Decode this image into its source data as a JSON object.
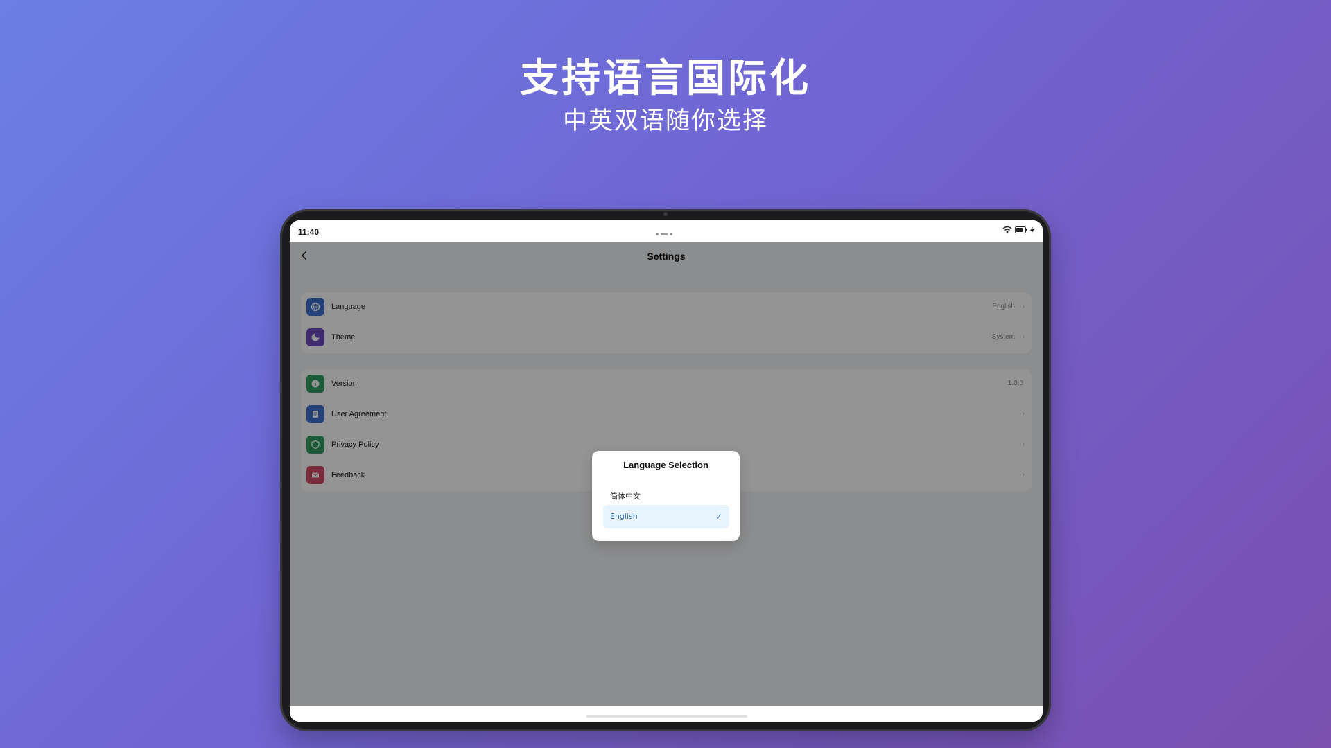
{
  "hero": {
    "title": "支持语言国际化",
    "subtitle": "中英双语随你选择"
  },
  "status_bar": {
    "time": "11:40",
    "icons": [
      "wifi-icon",
      "battery-icon",
      "charging-icon"
    ]
  },
  "header": {
    "title": "Settings",
    "back_icon": "chevron-left-icon"
  },
  "settings": {
    "group1": [
      {
        "label": "Language",
        "value": "English",
        "icon": "globe-icon",
        "color": "#3d6fd1"
      },
      {
        "label": "Theme",
        "value": "System",
        "icon": "palette-icon",
        "color": "#6b4bc0"
      }
    ],
    "group2": [
      {
        "label": "Version",
        "value": "1.0.0",
        "icon": "info-icon",
        "color": "#2f9e63"
      },
      {
        "label": "User Agreement",
        "value": "",
        "icon": "document-icon",
        "color": "#3d6fd1"
      },
      {
        "label": "Privacy Policy",
        "value": "",
        "icon": "shield-icon",
        "color": "#2f9e63"
      },
      {
        "label": "Feedback",
        "value": "",
        "icon": "mail-icon",
        "color": "#d04a66"
      }
    ]
  },
  "dialog": {
    "title": "Language Selection",
    "options": [
      {
        "label": "简体中文",
        "selected": false
      },
      {
        "label": "English",
        "selected": true
      }
    ],
    "check_mark": "✓"
  },
  "colors": {
    "background_start": "#6b7fe6",
    "background_end": "#7a4fb0",
    "selected_option_bg": "#e8f4fd",
    "accent": "#3a7bd5"
  }
}
